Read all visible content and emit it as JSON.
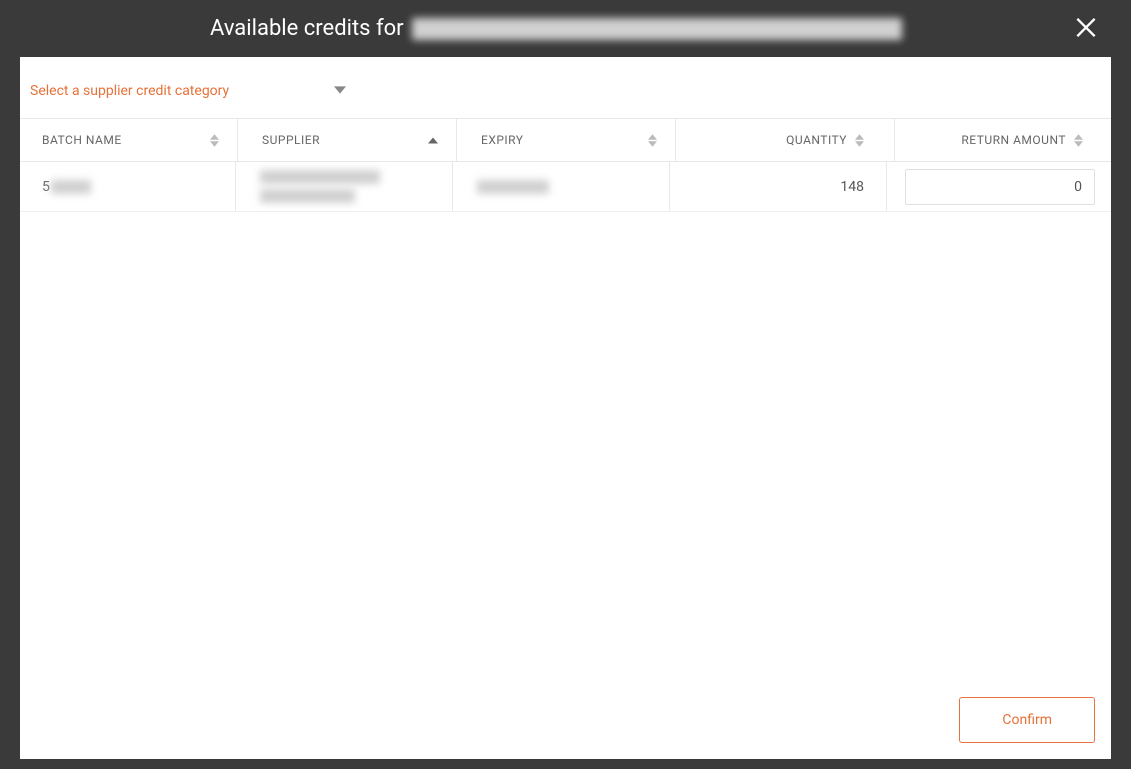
{
  "header": {
    "title_prefix": "Available credits for",
    "product_name_redacted": true
  },
  "category_selector": {
    "label": "Select a supplier credit category"
  },
  "table": {
    "columns": {
      "batch_name": "BATCH NAME",
      "supplier": "SUPPLIER",
      "expiry": "EXPIRY",
      "quantity": "QUANTITY",
      "return_amount": "RETURN AMOUNT"
    },
    "sort_column": "supplier",
    "sort_direction": "asc",
    "rows": [
      {
        "batch_name_prefix": "5",
        "batch_name_redacted": true,
        "supplier_redacted": true,
        "expiry_redacted": true,
        "quantity": "148",
        "return_amount": "0"
      }
    ]
  },
  "footer": {
    "confirm_label": "Confirm"
  },
  "colors": {
    "accent": "#e57238",
    "background_dark": "#3a3a3a"
  }
}
